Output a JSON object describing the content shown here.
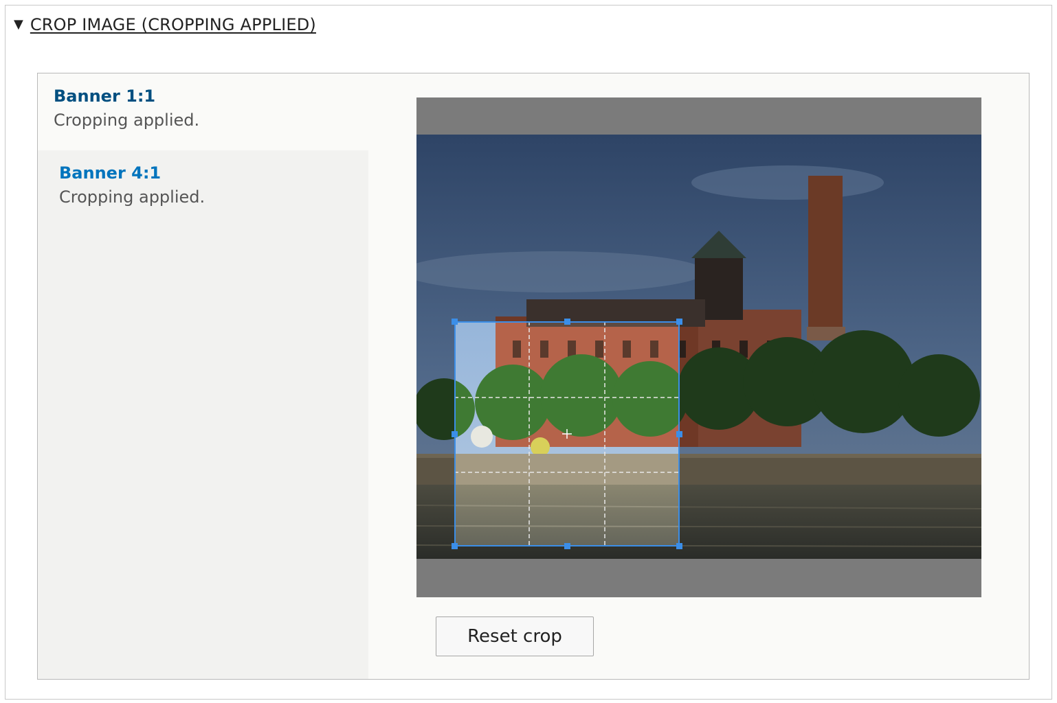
{
  "fieldset": {
    "toggle_icon": "triangle-down-icon",
    "summary_label": "CROP IMAGE (CROPPING APPLIED)"
  },
  "tabs": [
    {
      "title": "Banner 1:1",
      "summary": "Cropping applied.",
      "active": true
    },
    {
      "title": "Banner 4:1",
      "summary": "Cropping applied.",
      "active": false
    }
  ],
  "cropper": {
    "image_description": "photo",
    "crop_box_color": "#3b8ee8",
    "stage_background": "#7b7b7b"
  },
  "actions": {
    "reset_label": "Reset crop"
  },
  "colors": {
    "active_tab_title": "#004f80",
    "inactive_tab_title": "#0074bd",
    "tab_summary": "#555555",
    "tabs_background": "#f2f2f0",
    "panel_background": "#fafaf8"
  }
}
